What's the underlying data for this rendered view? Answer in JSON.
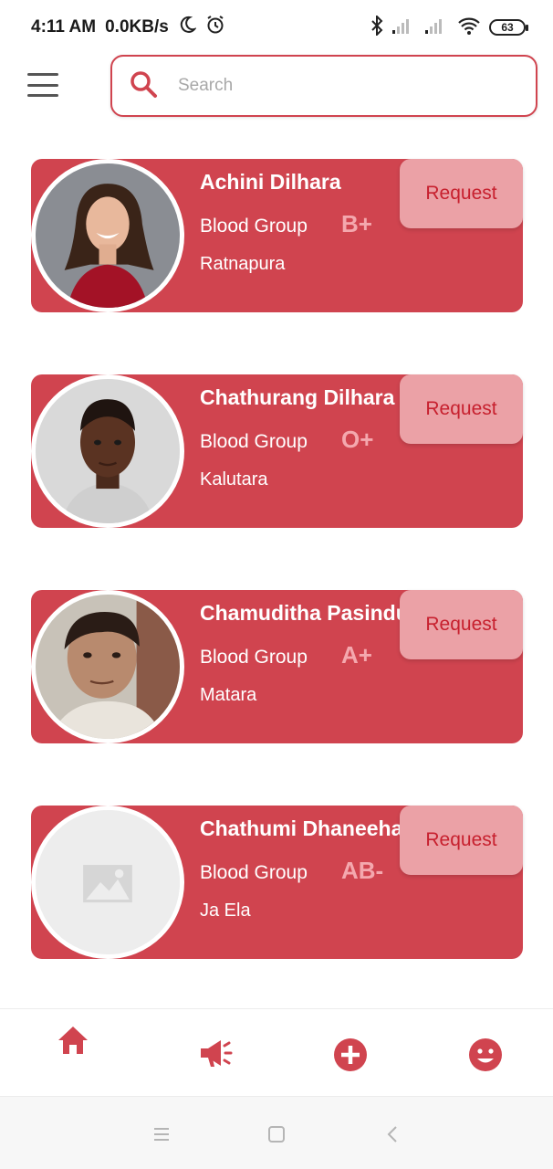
{
  "status_bar": {
    "time": "4:11 AM",
    "net_speed": "0.0KB/s",
    "battery_level": "63"
  },
  "search": {
    "placeholder": "Search"
  },
  "donors": [
    {
      "name": "Achini Dilhara",
      "blood_group_label": "Blood Group",
      "blood_group": "B+",
      "city": "Ratnapura",
      "request_label": "Request"
    },
    {
      "name": "Chathurang Dilhara",
      "blood_group_label": "Blood Group",
      "blood_group": "O+",
      "city": "Kalutara",
      "request_label": "Request"
    },
    {
      "name": "Chamuditha Pasindu",
      "blood_group_label": "Blood Group",
      "blood_group": "A+",
      "city": "Matara",
      "request_label": "Request"
    },
    {
      "name": "Chathumi Dhaneeha",
      "blood_group_label": "Blood Group",
      "blood_group": "AB-",
      "city": "Ja Ela",
      "request_label": "Request"
    }
  ],
  "bottom_nav": {
    "items": [
      {
        "icon": "home-icon"
      },
      {
        "icon": "megaphone-icon"
      },
      {
        "icon": "add-circle-icon"
      },
      {
        "icon": "smiley-face-icon"
      }
    ]
  },
  "colors": {
    "accent": "#d0444f",
    "request_button_bg": "#eba1a6",
    "request_text": "#c7202e",
    "blood_group_text": "#f4a8ae"
  }
}
